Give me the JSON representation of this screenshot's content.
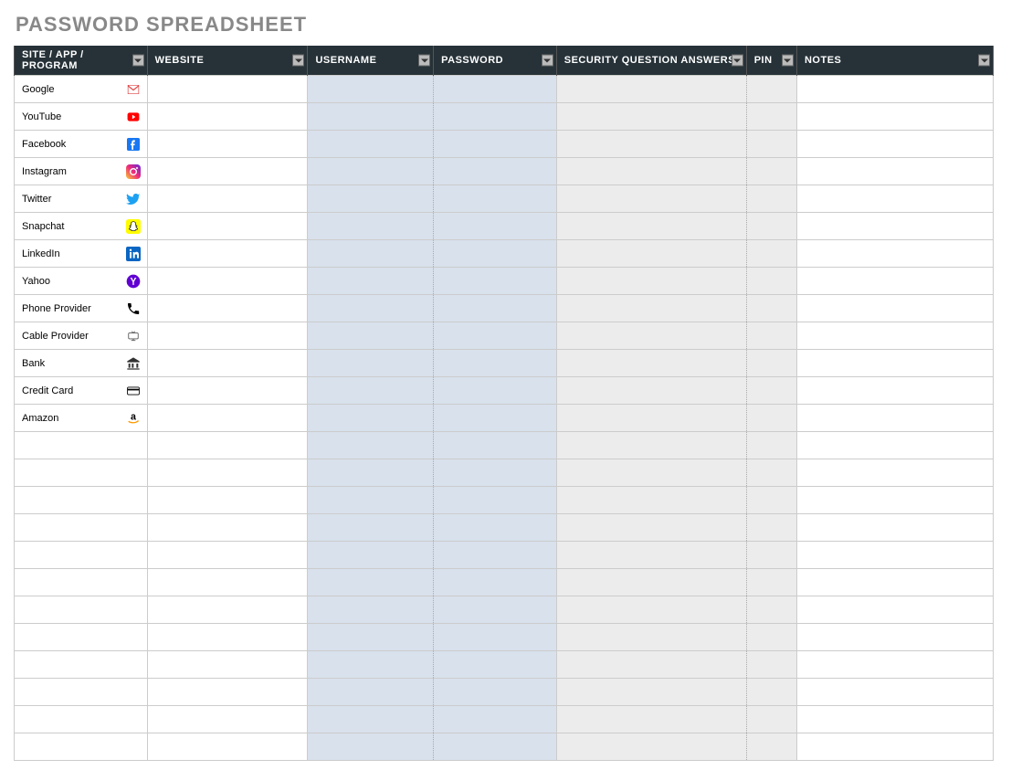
{
  "title": "PASSWORD SPREADSHEET",
  "columns": {
    "site": "SITE / APP / PROGRAM",
    "website": "WEBSITE",
    "username": "USERNAME",
    "password": "PASSWORD",
    "security": "SECURITY QUESTION ANSWERS",
    "pin": "PIN",
    "notes": "NOTES"
  },
  "rows": [
    {
      "site": "Google",
      "icon": "gmail"
    },
    {
      "site": "YouTube",
      "icon": "youtube"
    },
    {
      "site": "Facebook",
      "icon": "facebook"
    },
    {
      "site": "Instagram",
      "icon": "instagram"
    },
    {
      "site": "Twitter",
      "icon": "twitter"
    },
    {
      "site": "Snapchat",
      "icon": "snapchat"
    },
    {
      "site": "LinkedIn",
      "icon": "linkedin"
    },
    {
      "site": "Yahoo",
      "icon": "yahoo"
    },
    {
      "site": "Phone Provider",
      "icon": "phone"
    },
    {
      "site": "Cable Provider",
      "icon": "cable"
    },
    {
      "site": "Bank",
      "icon": "bank"
    },
    {
      "site": "Credit Card",
      "icon": "card"
    },
    {
      "site": "Amazon",
      "icon": "amazon"
    },
    {
      "site": "",
      "icon": ""
    },
    {
      "site": "",
      "icon": ""
    },
    {
      "site": "",
      "icon": ""
    },
    {
      "site": "",
      "icon": ""
    },
    {
      "site": "",
      "icon": ""
    },
    {
      "site": "",
      "icon": ""
    },
    {
      "site": "",
      "icon": ""
    },
    {
      "site": "",
      "icon": ""
    },
    {
      "site": "",
      "icon": ""
    },
    {
      "site": "",
      "icon": ""
    },
    {
      "site": "",
      "icon": ""
    },
    {
      "site": "",
      "icon": ""
    }
  ]
}
